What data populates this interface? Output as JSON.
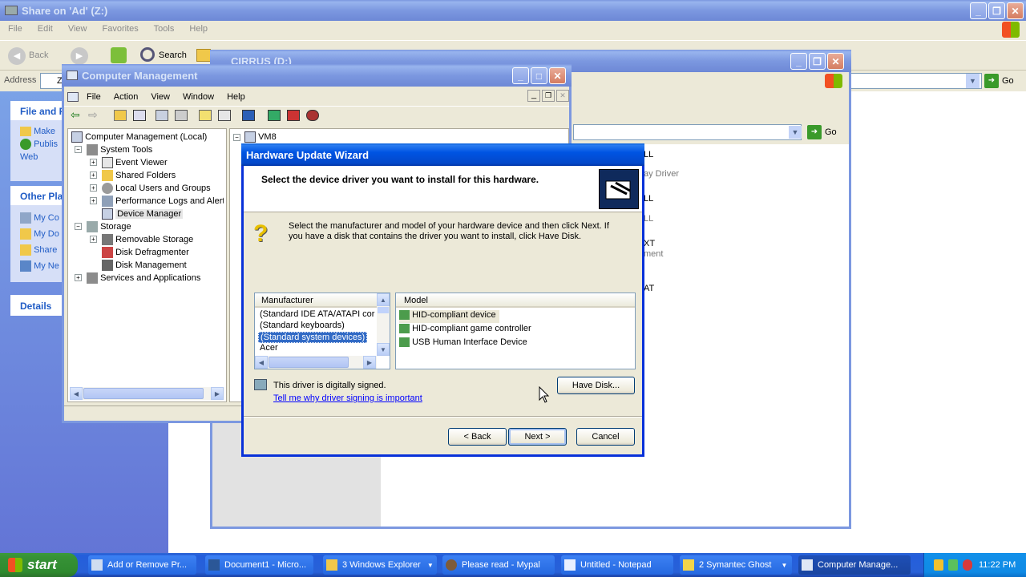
{
  "explorer": {
    "title": "Share on 'Ad' (Z:)",
    "menu": [
      "File",
      "Edit",
      "View",
      "Favorites",
      "Tools",
      "Help"
    ],
    "back_label": "Back",
    "search_label": "Search",
    "address_label": "Address",
    "address_value": "Z:",
    "go_label": "Go",
    "panel_file_title": "File and F",
    "panel_file_items": [
      "Make",
      "Publis Web"
    ],
    "panel_other_title": "Other Pla",
    "panel_other_items": [
      "My Co",
      "My Do",
      "Share",
      "My Ne"
    ],
    "details_label": "Details"
  },
  "cirrus": {
    "title": "CIRRUS (D:)",
    "go_label": "Go",
    "right_items": [
      "LL",
      "ay Driver",
      "LL",
      "LL",
      "XT",
      "ment",
      "AT"
    ]
  },
  "compmgmt": {
    "title": "Computer Management",
    "menu": [
      "File",
      "Action",
      "View",
      "Window",
      "Help"
    ],
    "tree": [
      {
        "label": "Computer Management (Local)",
        "level": 0
      },
      {
        "label": "System Tools",
        "level": 1
      },
      {
        "label": "Event Viewer",
        "level": 2
      },
      {
        "label": "Shared Folders",
        "level": 2
      },
      {
        "label": "Local Users and Groups",
        "level": 2
      },
      {
        "label": "Performance Logs and Alerts",
        "level": 2
      },
      {
        "label": "Device Manager",
        "level": 2
      },
      {
        "label": "Storage",
        "level": 1
      },
      {
        "label": "Removable Storage",
        "level": 2
      },
      {
        "label": "Disk Defragmenter",
        "level": 2
      },
      {
        "label": "Disk Management",
        "level": 2
      },
      {
        "label": "Services and Applications",
        "level": 1
      }
    ],
    "right_root": "VM8"
  },
  "wizard": {
    "title": "Hardware Update Wizard",
    "header": "Select the device driver you want to install for this hardware.",
    "instructions": "Select the manufacturer and model of your hardware device and then click Next. If you have a disk that contains the driver you want to install, click Have Disk.",
    "manufacturer_header": "Manufacturer",
    "manufacturers": [
      "(Standard IDE ATA/ATAPI cor",
      "(Standard keyboards)",
      "(Standard system devices)",
      "Acer"
    ],
    "selected_manufacturer": "(Standard system devices)",
    "model_header": "Model",
    "models": [
      "HID-compliant device",
      "HID-compliant game controller",
      "USB Human Interface Device"
    ],
    "signed_text": "This driver is digitally signed.",
    "signing_link": "Tell me why driver signing is important",
    "have_disk": "Have Disk...",
    "back": "< Back",
    "next": "Next >",
    "cancel": "Cancel"
  },
  "taskbar": {
    "start": "start",
    "items": [
      "Add or Remove Pr...",
      "Document1 - Micro...",
      "3 Windows Explorer",
      "Please read - Mypal",
      "Untitled - Notepad",
      "2 Symantec Ghost",
      "Computer Manage..."
    ],
    "clock": "11:22 PM"
  }
}
